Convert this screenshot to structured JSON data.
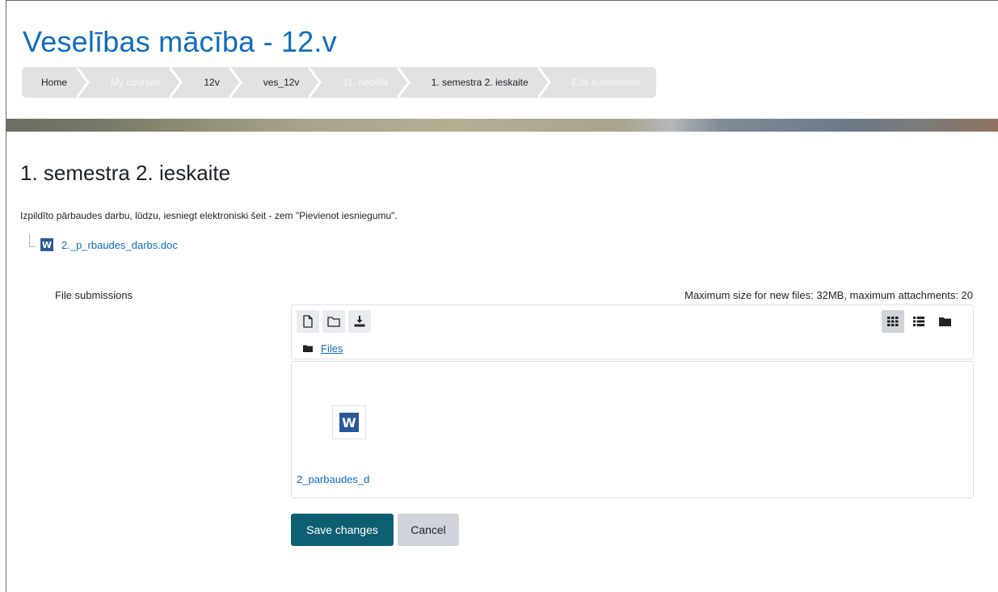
{
  "course": {
    "title": "Veselības mācība - 12.v"
  },
  "breadcrumb": [
    {
      "label": "Home",
      "muted": false
    },
    {
      "label": "My courses",
      "muted": true
    },
    {
      "label": "12v",
      "muted": false
    },
    {
      "label": "ves_12v",
      "muted": false
    },
    {
      "label": "11. nedēla",
      "muted": true
    },
    {
      "label": "1. semestra 2. ieskaite",
      "muted": false
    },
    {
      "label": "Edit submission",
      "muted": true
    }
  ],
  "page": {
    "heading": "1. semestra 2. ieskaite",
    "intro": "Izpildīto pārbaudes darbu, lūdzu, iesniegt elektroniski šeit - zem \"Pievienot iesniegumu\".",
    "attachment": {
      "name": "2._p_rbaudes_darbs.doc",
      "icon": "word-icon"
    }
  },
  "form": {
    "field_label": "File submissions",
    "max_size_text": "Maximum size for new files: 32MB, maximum attachments: 20",
    "filepicker": {
      "toolbar": {
        "left_icons": [
          "add-file-icon",
          "create-folder-icon",
          "download-icon"
        ],
        "right_icons": [
          "grid-view-icon",
          "list-view-icon",
          "tree-view-icon"
        ],
        "active_view": "grid-view-icon"
      },
      "path_label": "Files",
      "files": [
        {
          "name": "2_parbaudes_d",
          "icon": "word-icon"
        }
      ]
    },
    "save_label": "Save changes",
    "cancel_label": "Cancel"
  },
  "colors": {
    "link": "#0f6cbf",
    "primary_button": "#0f5f72",
    "secondary_button": "#ced4da",
    "breadcrumb_bg": "#e2e2e2",
    "word_blue": "#2b579a"
  }
}
